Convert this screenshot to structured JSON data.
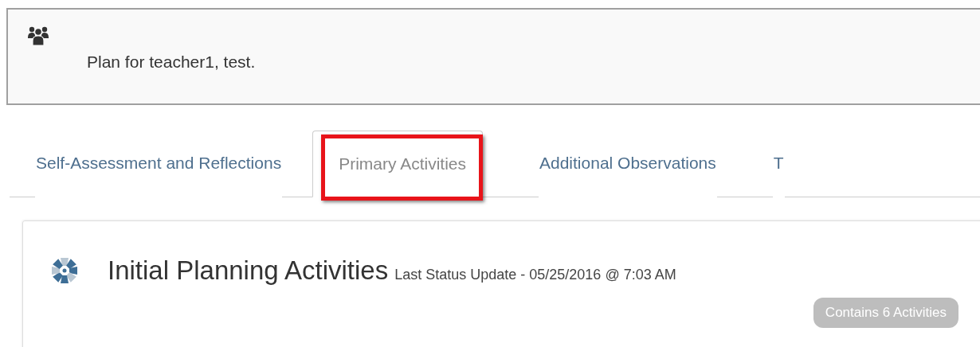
{
  "plan_header": {
    "text": "Plan for teacher1, test."
  },
  "tabs": [
    {
      "label": "Self-Assessment and Reflections",
      "selected": false,
      "highlighted": false
    },
    {
      "label": "Primary Activities",
      "selected": true,
      "highlighted": true
    },
    {
      "label": "Additional Observations",
      "selected": false,
      "highlighted": false
    },
    {
      "label": "T",
      "selected": false,
      "highlighted": false
    }
  ],
  "activity_group": {
    "title": "Initial Planning Activities",
    "status": "Last Status Update - 05/25/2016 @ 7:03 AM",
    "badge": "Contains 6 Activities"
  }
}
